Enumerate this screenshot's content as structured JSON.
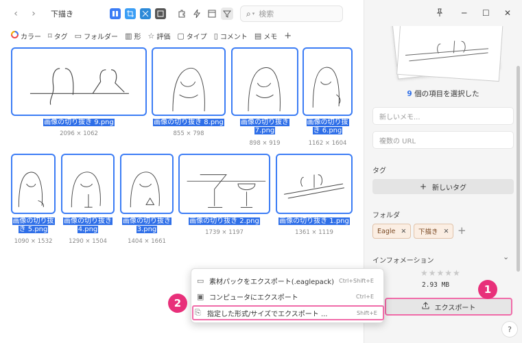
{
  "toolbar": {
    "back": "‹",
    "forward": "›",
    "crumb": "下描き",
    "search_icon": "⌕",
    "search_placeholder": "検索"
  },
  "tagbar": [
    {
      "icon": "color-wheel-icon",
      "label": "カラー"
    },
    {
      "icon": "tag-icon",
      "label": "タグ"
    },
    {
      "icon": "folder-icon",
      "label": "フォルダー"
    },
    {
      "icon": "shape-icon",
      "label": "形"
    },
    {
      "icon": "star-icon",
      "label": "評価"
    },
    {
      "icon": "type-icon",
      "label": "タイプ"
    },
    {
      "icon": "comment-icon",
      "label": "コメント"
    },
    {
      "icon": "memo-icon",
      "label": "メモ"
    }
  ],
  "items": [
    {
      "name": "画像の切り抜き 9.png",
      "dims": "2096 × 1062"
    },
    {
      "name": "画像の切り抜き 8.png",
      "dims": "855 × 798"
    },
    {
      "name": "画像の切り抜き 7.png",
      "dims": "898 × 919"
    },
    {
      "name": "画像の切り抜き 6.png",
      "dims": "1162 × 1604"
    },
    {
      "name": "画像の切り抜き 5.png",
      "dims": "1090 × 1532"
    },
    {
      "name": "画像の切り抜き 4.png",
      "dims": "1290 × 1504"
    },
    {
      "name": "画像の切り抜き 3.png",
      "dims": "1404 × 1661"
    },
    {
      "name": "画像の切り抜き 2.png",
      "dims": "1739 × 1197"
    },
    {
      "name": "画像の切り抜き 1.png",
      "dims": "1361 × 1119"
    }
  ],
  "labels": [
    [
      "画像の切り抜き 9.png"
    ],
    [
      "画像の切り抜き 8.png"
    ],
    [
      "画像の切り抜き",
      "7.png"
    ],
    [
      "画像の切り抜",
      "き 6.png"
    ],
    [
      "画像の切り抜",
      "き 5.png"
    ],
    [
      "画像の切り抜き",
      "4.png"
    ],
    [
      "画像の切り抜き",
      "3.png"
    ],
    [
      "画像の切り抜き 2.png"
    ],
    [
      "画像の切り抜き 1.png"
    ]
  ],
  "panel": {
    "selected_count": "9",
    "selected_text": " 個の項目を選択した",
    "memo_placeholder": "新しいメモ...",
    "url_placeholder": "複数の URL",
    "tag_heading": "タグ",
    "new_tag": "新しいタグ",
    "folder_heading": "フォルダ",
    "folders": [
      "Eagle",
      "下描き"
    ],
    "info_heading": "インフォメーション",
    "size": "2.93 MB",
    "export": "エクスポート",
    "help": "?"
  },
  "context_menu": [
    {
      "icon": "package-icon",
      "label": "素材パックをエクスポート(.eaglepack)",
      "shortcut": "Ctrl+Shift+E"
    },
    {
      "icon": "computer-icon",
      "label": "コンピュータにエクスポート",
      "shortcut": "Ctrl+E"
    },
    {
      "icon": "export-file-icon",
      "label": "指定した形式/サイズでエクスポート ...",
      "shortcut": "Shift+E"
    }
  ],
  "badges": {
    "one": "1",
    "two": "2"
  },
  "colors": {
    "accent": "#2f6fe8",
    "badge": "#e8307a",
    "highlight_border": "#f06aa8"
  }
}
